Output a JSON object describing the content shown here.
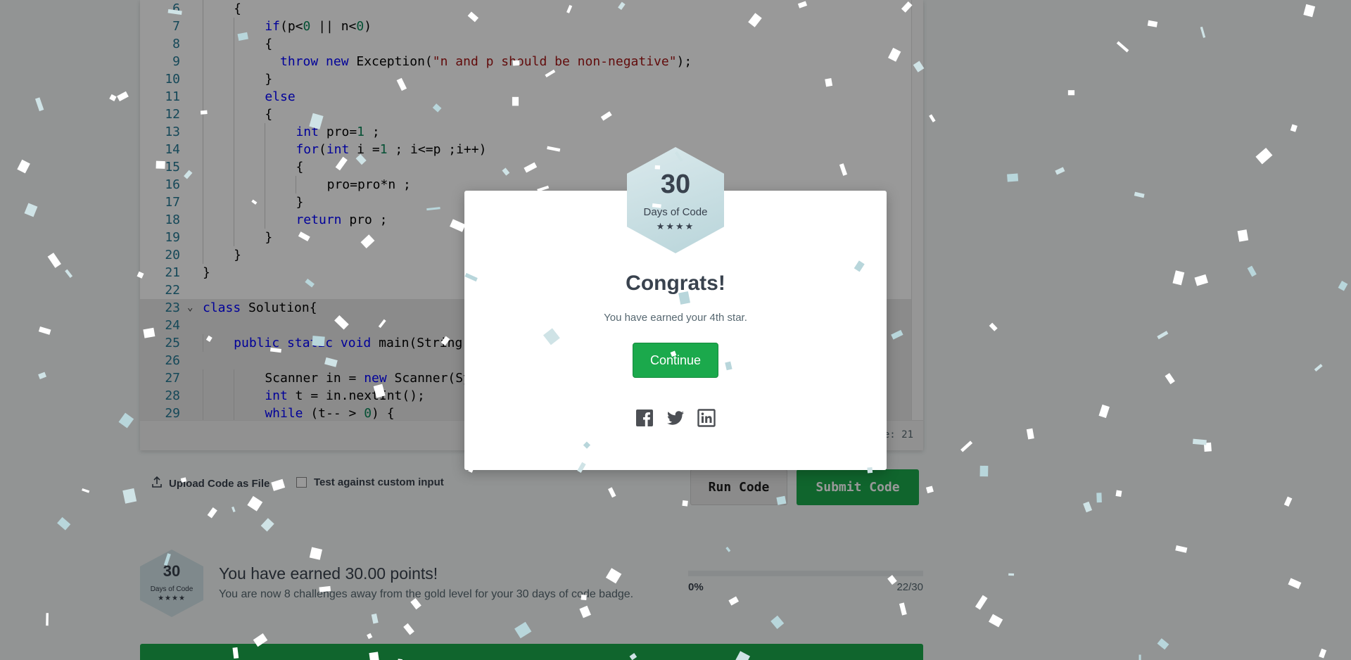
{
  "editor": {
    "lines": [
      {
        "n": "6",
        "indent": 1,
        "tokens": [
          [
            "p",
            "{"
          ]
        ]
      },
      {
        "n": "7",
        "indent": 2,
        "tokens": [
          [
            "k",
            "if"
          ],
          [
            "p",
            "(p<"
          ],
          [
            "n",
            "0"
          ],
          [
            "p",
            " || n<"
          ],
          [
            "n",
            "0"
          ],
          [
            "p",
            ")"
          ]
        ]
      },
      {
        "n": "8",
        "indent": 2,
        "tokens": [
          [
            "p",
            "{"
          ]
        ]
      },
      {
        "n": "9",
        "indent": 2,
        "pad": "  ",
        "tokens": [
          [
            "k",
            "throw"
          ],
          [
            "p",
            " "
          ],
          [
            "k",
            "new"
          ],
          [
            "p",
            " Exception("
          ],
          [
            "s",
            "\"n and p should be non-negative\""
          ],
          [
            "p",
            ");"
          ]
        ]
      },
      {
        "n": "10",
        "indent": 2,
        "tokens": [
          [
            "p",
            "}"
          ]
        ]
      },
      {
        "n": "11",
        "indent": 2,
        "tokens": [
          [
            "k",
            "else"
          ]
        ]
      },
      {
        "n": "12",
        "indent": 2,
        "tokens": [
          [
            "p",
            "{"
          ]
        ]
      },
      {
        "n": "13",
        "indent": 3,
        "tokens": [
          [
            "k",
            "int"
          ],
          [
            "p",
            " pro="
          ],
          [
            "n",
            "1"
          ],
          [
            "p",
            " ;"
          ]
        ]
      },
      {
        "n": "14",
        "indent": 3,
        "tokens": [
          [
            "k",
            "for"
          ],
          [
            "p",
            "("
          ],
          [
            "k",
            "int"
          ],
          [
            "p",
            " i ="
          ],
          [
            "n",
            "1"
          ],
          [
            "p",
            " ; i<=p ;i++)"
          ]
        ]
      },
      {
        "n": "15",
        "indent": 3,
        "tokens": [
          [
            "p",
            "{"
          ]
        ]
      },
      {
        "n": "16",
        "indent": 4,
        "tokens": [
          [
            "p",
            "pro=pro*n ;"
          ]
        ]
      },
      {
        "n": "17",
        "indent": 3,
        "tokens": [
          [
            "p",
            "}"
          ]
        ]
      },
      {
        "n": "18",
        "indent": 3,
        "tokens": [
          [
            "k",
            "return"
          ],
          [
            "p",
            " pro ;"
          ]
        ]
      },
      {
        "n": "19",
        "indent": 2,
        "tokens": [
          [
            "p",
            "}"
          ]
        ]
      },
      {
        "n": "20",
        "indent": 1,
        "tokens": [
          [
            "p",
            "}"
          ]
        ]
      },
      {
        "n": "21",
        "indent": 0,
        "tokens": [
          [
            "p",
            "}"
          ]
        ]
      },
      {
        "n": "22",
        "indent": 0,
        "tokens": []
      },
      {
        "n": "23",
        "indent": 0,
        "fold": true,
        "hl": true,
        "tokens": [
          [
            "k",
            "class"
          ],
          [
            "p",
            " Solution{"
          ]
        ]
      },
      {
        "n": "24",
        "indent": 0,
        "hl": true,
        "tokens": []
      },
      {
        "n": "25",
        "indent": 1,
        "hl": true,
        "tokens": [
          [
            "k",
            "public"
          ],
          [
            "p",
            " "
          ],
          [
            "k",
            "static"
          ],
          [
            "p",
            " "
          ],
          [
            "k",
            "void"
          ],
          [
            "p",
            " main(String[] args) {"
          ]
        ]
      },
      {
        "n": "26",
        "indent": 0,
        "hl": true,
        "tokens": []
      },
      {
        "n": "27",
        "indent": 2,
        "hl": true,
        "tokens": [
          [
            "p",
            "Scanner in = "
          ],
          [
            "k",
            "new"
          ],
          [
            "p",
            " Scanner(System.in);"
          ]
        ]
      },
      {
        "n": "28",
        "indent": 2,
        "hl": true,
        "tokens": [
          [
            "k",
            "int"
          ],
          [
            "p",
            " t = in.nextInt();"
          ]
        ]
      },
      {
        "n": "29",
        "indent": 2,
        "hl": true,
        "tokens": [
          [
            "k",
            "while"
          ],
          [
            "p",
            " (t-- > "
          ],
          [
            "n",
            "0"
          ],
          [
            "p",
            ") {"
          ]
        ]
      }
    ],
    "status": "Line: 21"
  },
  "actions": {
    "upload": "Upload Code as File",
    "custom_input": "Test against custom input",
    "run": "Run Code",
    "submit": "Submit Code"
  },
  "points": {
    "badge": {
      "number": "30",
      "label": "Days of Code",
      "stars": "★★★★"
    },
    "title": "You have earned 30.00 points!",
    "subtitle": "You are now 8 challenges away from the gold level for your 30 days of code badge.",
    "progress_label": "0%",
    "progress_fraction": 0,
    "progress_count": "22/30"
  },
  "modal": {
    "badge": {
      "number": "30",
      "label": "Days of Code",
      "stars": "★★★★"
    },
    "title": "Congrats!",
    "message": "You have earned your 4th star.",
    "continue": "Continue",
    "share": [
      "facebook-icon",
      "twitter-icon",
      "linkedin-icon"
    ]
  },
  "colors": {
    "accent_green": "#1ba94c",
    "keyword": "#0000ff",
    "number": "#098658",
    "string": "#a31515",
    "share_icon": "#4c4f54"
  }
}
